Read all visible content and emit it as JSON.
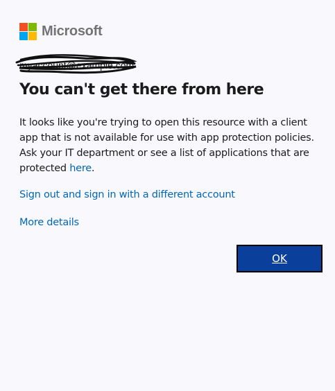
{
  "brand": {
    "name": "Microsoft",
    "colors": [
      "#f25022",
      "#7fba00",
      "#00a4ef",
      "#ffb900"
    ]
  },
  "account": {
    "email": "myaccount@example.com",
    "redacted": true
  },
  "title": "You can't get there from here",
  "description": {
    "text_before_link": "It looks like you're trying to open this resource with a client app that is not available for use with app protection policies. Ask your IT department or see a list of applications that are protected ",
    "link_label": "here",
    "text_after_link": "."
  },
  "links": {
    "sign_out": "Sign out and sign in with a different account",
    "more_details": "More details"
  },
  "buttons": {
    "ok": "OK"
  },
  "colors": {
    "link": "#0067b8",
    "button_bg": "#0a3f9c",
    "page_bg": "#f9f8fd"
  }
}
